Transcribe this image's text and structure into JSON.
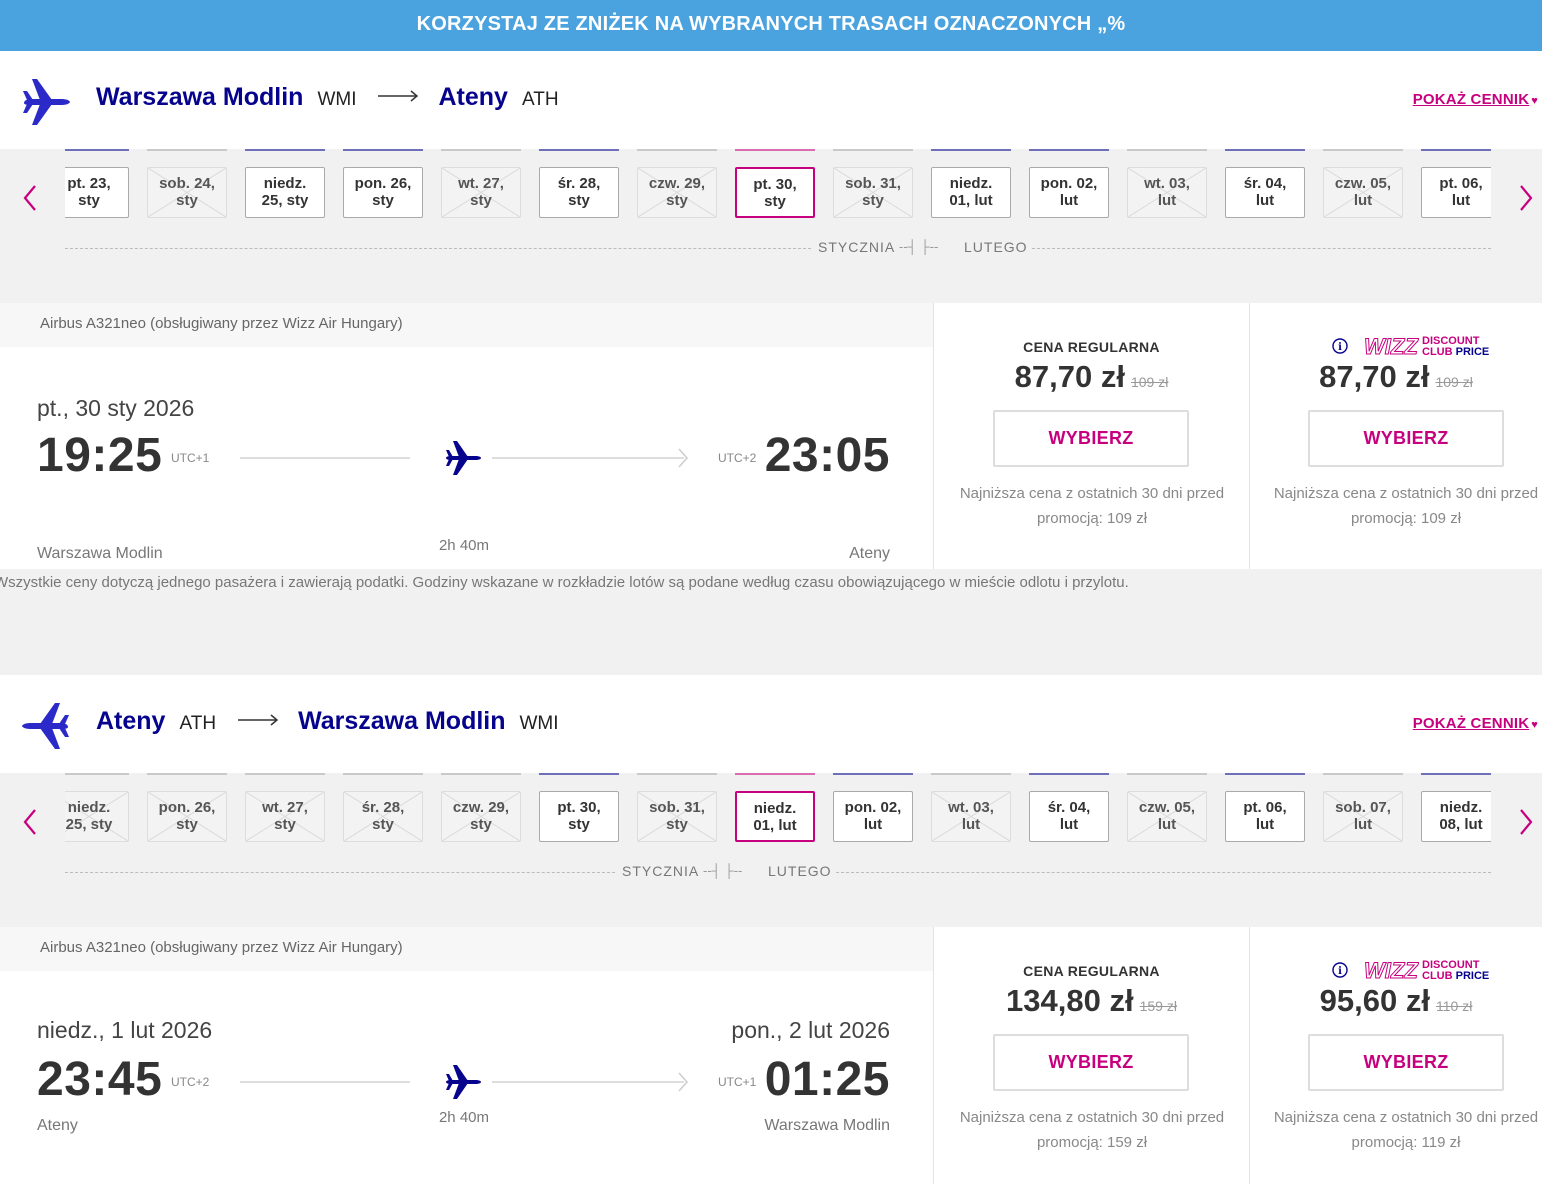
{
  "banner": {
    "text": "KORZYSTAJ ZE ZNIŻEK NA WYBRANYCH TRASACH OZNACZONYCH „%"
  },
  "colors": {
    "brand_blue": "#06038d",
    "brand_pink": "#c6007e",
    "banner_bg": "#4aa3df"
  },
  "disclaimer": "Wszystkie ceny dotyczą jednego pasażera i zawierają podatki. Godziny wskazane w rozkładzie lotów są podane według czasu obowiązującego w mieście odlotu i przylotu.",
  "outbound": {
    "from_city": "Warszawa Modlin",
    "from_code": "WMI",
    "to_city": "Ateny",
    "to_code": "ATH",
    "pricelist_label": "POKAŻ CENNIK",
    "dates": [
      {
        "label": "pt. 23,\nsty",
        "available": true
      },
      {
        "label": "sob. 24,\nsty",
        "available": false
      },
      {
        "label": "niedz.\n25, sty",
        "available": true
      },
      {
        "label": "pon. 26,\nsty",
        "available": true
      },
      {
        "label": "wt. 27,\nsty",
        "available": false
      },
      {
        "label": "śr. 28,\nsty",
        "available": true
      },
      {
        "label": "czw. 29,\nsty",
        "available": false
      },
      {
        "label": "pt. 30,\nsty",
        "available": true,
        "selected": true
      },
      {
        "label": "sob. 31,\nsty",
        "available": false
      },
      {
        "label": "niedz.\n01, lut",
        "available": true
      },
      {
        "label": "pon. 02,\nlut",
        "available": true
      },
      {
        "label": "wt. 03,\nlut",
        "available": false
      },
      {
        "label": "śr. 04,\nlut",
        "available": true
      },
      {
        "label": "czw. 05,\nlut",
        "available": false
      },
      {
        "label": "pt. 06,\nlut",
        "available": true
      }
    ],
    "month_left": "STYCZNIA",
    "month_right": "LUTEGO",
    "aircraft": "Airbus A321neo (obsługiwany przez Wizz Air Hungary)",
    "dep_date": "pt., 30 sty 2026",
    "arr_date": "",
    "dep_time": "19:25",
    "dep_utc": "UTC+1",
    "arr_time": "23:05",
    "arr_utc": "UTC+2",
    "dep_city": "Warszawa Modlin",
    "arr_city": "Ateny",
    "duration": "2h 40m",
    "regular": {
      "title": "CENA REGULARNA",
      "price": "87,70 zł",
      "old_price": "109 zł",
      "button": "WYBIERZ",
      "lowest": "Najniższa cena z ostatnich 30 dni przed promocją: 109 zł"
    },
    "club": {
      "logo_text": "WIZZ DISCOUNT CLUB PRICE",
      "price": "87,70 zł",
      "old_price": "109 zł",
      "button": "WYBIERZ",
      "lowest": "Najniższa cena z ostatnich 30 dni przed promocją: 109 zł"
    }
  },
  "inbound": {
    "from_city": "Ateny",
    "from_code": "ATH",
    "to_city": "Warszawa Modlin",
    "to_code": "WMI",
    "pricelist_label": "POKAŻ CENNIK",
    "dates": [
      {
        "label": "niedz.\n25, sty",
        "available": false
      },
      {
        "label": "pon. 26,\nsty",
        "available": false
      },
      {
        "label": "wt. 27,\nsty",
        "available": false
      },
      {
        "label": "śr. 28,\nsty",
        "available": false
      },
      {
        "label": "czw. 29,\nsty",
        "available": false
      },
      {
        "label": "pt. 30,\nsty",
        "available": true
      },
      {
        "label": "sob. 31,\nsty",
        "available": false
      },
      {
        "label": "niedz.\n01, lut",
        "available": true,
        "selected": true
      },
      {
        "label": "pon. 02,\nlut",
        "available": true
      },
      {
        "label": "wt. 03,\nlut",
        "available": false
      },
      {
        "label": "śr. 04,\nlut",
        "available": true
      },
      {
        "label": "czw. 05,\nlut",
        "available": false
      },
      {
        "label": "pt. 06,\nlut",
        "available": true
      },
      {
        "label": "sob. 07,\nlut",
        "available": false
      },
      {
        "label": "niedz.\n08, lut",
        "available": true
      }
    ],
    "month_left": "STYCZNIA",
    "month_right": "LUTEGO",
    "aircraft": "Airbus A321neo (obsługiwany przez Wizz Air Hungary)",
    "dep_date": "niedz., 1 lut 2026",
    "arr_date": "pon., 2 lut 2026",
    "dep_time": "23:45",
    "dep_utc": "UTC+2",
    "arr_time": "01:25",
    "arr_utc": "UTC+1",
    "dep_city": "Ateny",
    "arr_city": "Warszawa Modlin",
    "duration": "2h 40m",
    "regular": {
      "title": "CENA REGULARNA",
      "price": "134,80 zł",
      "old_price": "159 zł",
      "button": "WYBIERZ",
      "lowest": "Najniższa cena z ostatnich 30 dni przed promocją: 159 zł"
    },
    "club": {
      "logo_text": "WIZZ DISCOUNT CLUB PRICE",
      "price": "95,60 zł",
      "old_price": "110 zł",
      "button": "WYBIERZ",
      "lowest": "Najniższa cena z ostatnich 30 dni przed promocją: 119 zł"
    }
  }
}
